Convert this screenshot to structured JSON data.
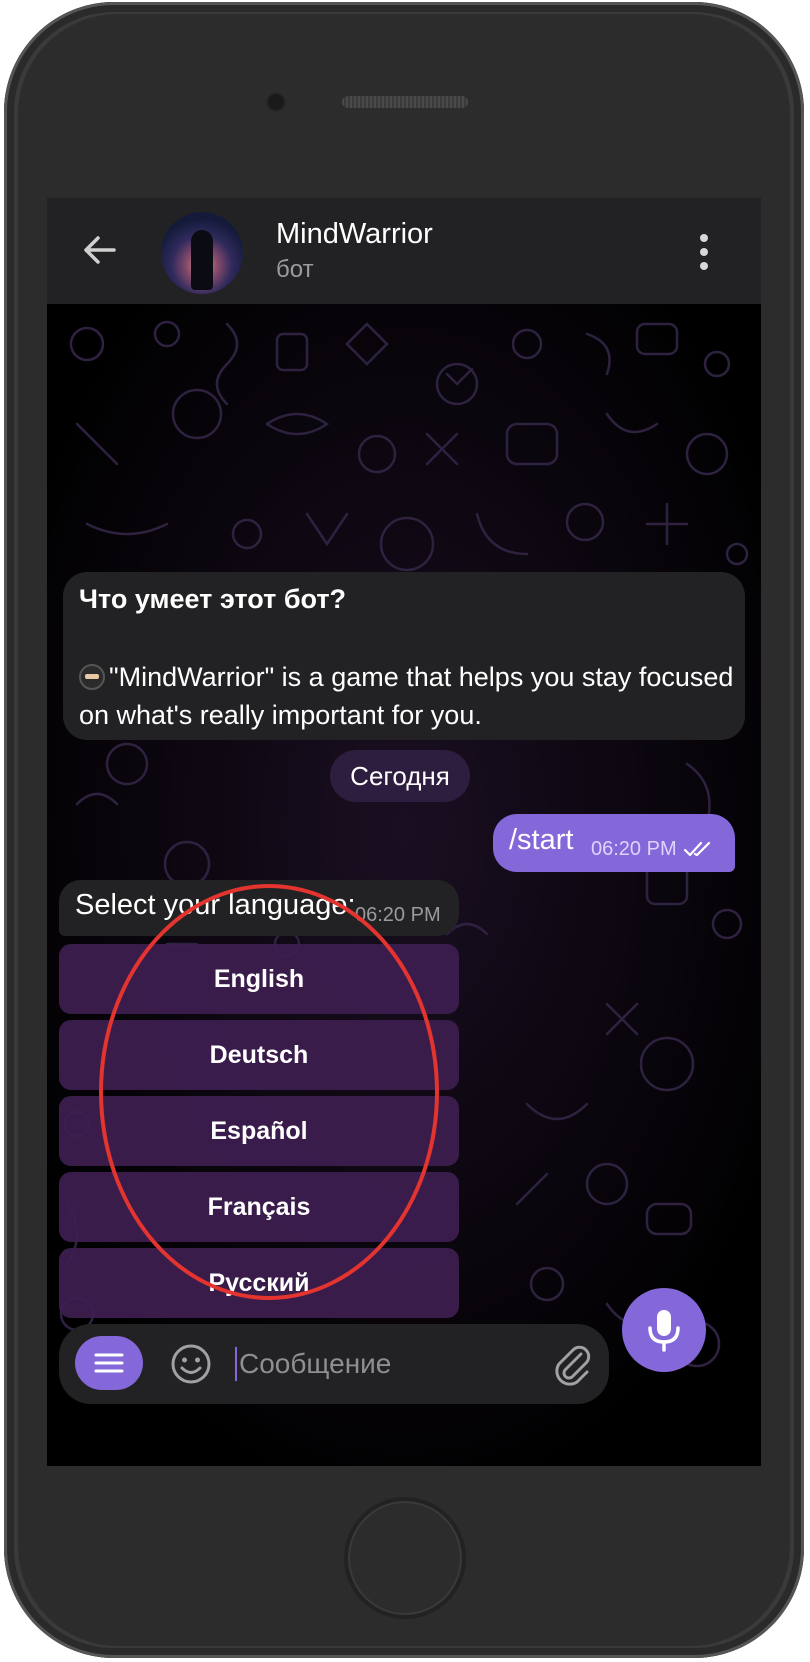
{
  "header": {
    "title": "MindWarrior",
    "subtitle": "бот"
  },
  "info": {
    "title": "Что умеет этот бот?",
    "body": "\"MindWarrior\" is a game that helps you stay focused on what's really important for you."
  },
  "date_separator": "Сегодня",
  "outgoing": {
    "text": "/start",
    "time": "06:20 PM"
  },
  "incoming": {
    "text": "Select your language:",
    "time": "06:20 PM"
  },
  "keyboard": {
    "buttons": [
      {
        "label": "English"
      },
      {
        "label": "Deutsch"
      },
      {
        "label": "Español"
      },
      {
        "label": "Français"
      },
      {
        "label": "Русский"
      }
    ]
  },
  "composer": {
    "placeholder": "Сообщение"
  },
  "colors": {
    "accent": "#8468d9",
    "header_bg": "#222224",
    "keyboard_button_bg": "#3e1e50",
    "highlight": "#e3342f"
  },
  "icons": {
    "back": "arrow-left-icon",
    "menu": "more-vertical-icon",
    "bot_menu": "hamburger-icon",
    "emoji": "smile-icon",
    "attach": "paperclip-icon",
    "mic": "microphone-icon",
    "read": "double-check-icon"
  }
}
